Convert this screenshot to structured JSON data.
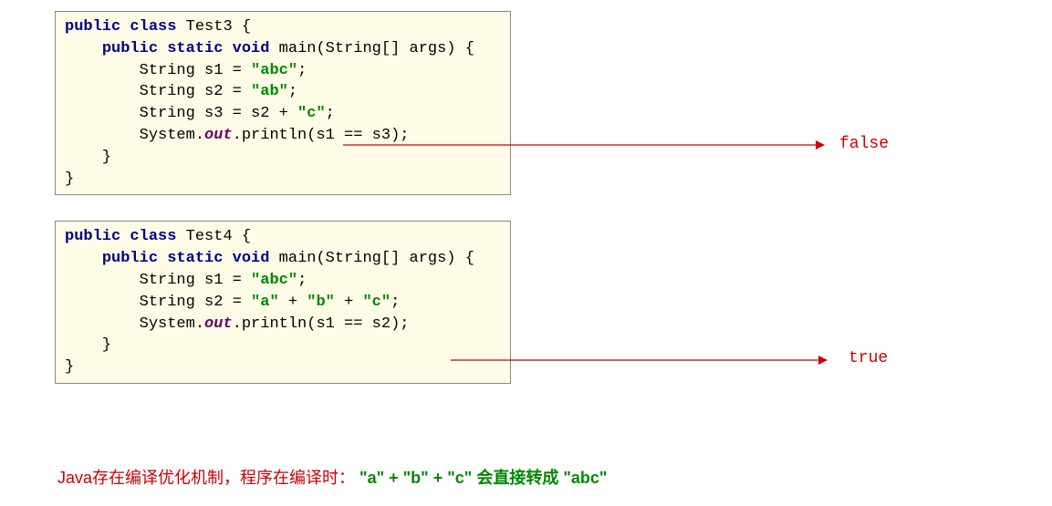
{
  "block1": {
    "t0": "public",
    "t1": " ",
    "t2": "class",
    "t3": " Test3 {",
    "l2a": "    ",
    "l2b": "public",
    "l2c": " ",
    "l2d": "static",
    "l2e": " ",
    "l2f": "void",
    "l2g": " main(String[] args) {",
    "l3a": "        String s1 = ",
    "l3b": "\"abc\"",
    "l3c": ";",
    "l4a": "        String s2 = ",
    "l4b": "\"ab\"",
    "l4c": ";",
    "l5a": "        String s3 = s2 + ",
    "l5b": "\"c\"",
    "l5c": ";",
    "l6a": "        System.",
    "l6b": "out",
    "l6c": ".println(s1 == s3);",
    "l7": "    }",
    "l8": "}"
  },
  "result1": "false",
  "block2": {
    "t0": "public",
    "t1": " ",
    "t2": "class",
    "t3": " Test4 {",
    "l2a": "    ",
    "l2b": "public",
    "l2c": " ",
    "l2d": "static",
    "l2e": " ",
    "l2f": "void",
    "l2g": " main(String[] args) {",
    "l3a": "        String s1 = ",
    "l3b": "\"abc\"",
    "l3c": ";",
    "l4a": "        String s2 = ",
    "l4b": "\"a\"",
    "l4c": " + ",
    "l4d": "\"b\"",
    "l4e": " + ",
    "l4f": "\"c\"",
    "l4g": ";",
    "l5a": "        System.",
    "l5b": "out",
    "l5c": ".println(s1 == s2);",
    "l6": "    }",
    "l7": "}"
  },
  "result2": "true",
  "footer": {
    "a": "Java存在编译优化机制，程序在编译时： ",
    "b": "\"a\"",
    "c": " + ",
    "d": "\"b\"",
    "e": " + ",
    "f": "\"c\"",
    "g": " 会直接转成 ",
    "h": "\"abc\""
  }
}
